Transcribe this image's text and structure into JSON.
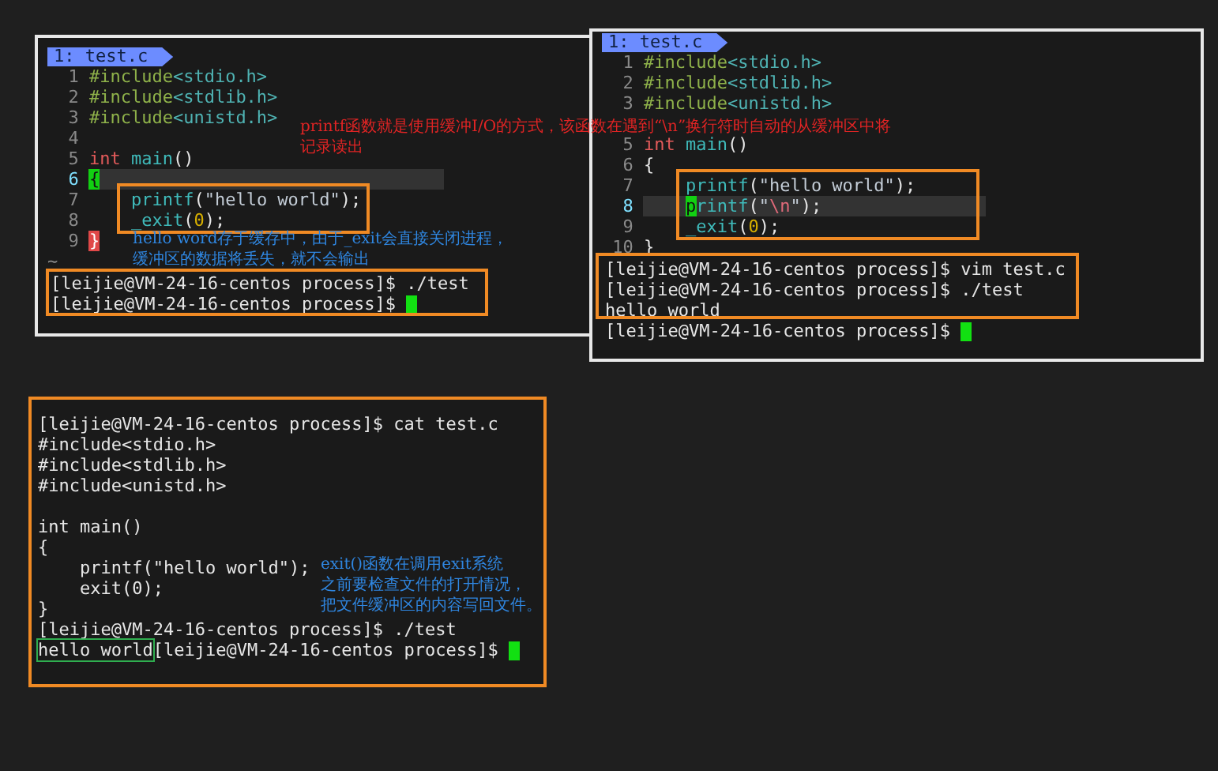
{
  "overlay_note": {
    "color": "#e02424",
    "lines": [
      "printf函数就是使用缓冲I/O的方式，该函数在遇到“\\n”换行符时自动的从缓冲区中将",
      "记录读出"
    ]
  },
  "panels": [
    {
      "kind": "vim",
      "tab": "1: test.c",
      "lines": [
        {
          "number": "1",
          "current": false,
          "tokens": [
            {
              "kind": "pre",
              "text": "#include"
            },
            {
              "kind": "hdr",
              "text": "<stdio.h>"
            }
          ]
        },
        {
          "number": "2",
          "current": false,
          "tokens": [
            {
              "kind": "pre",
              "text": "#include"
            },
            {
              "kind": "hdr",
              "text": "<stdlib.h>"
            }
          ]
        },
        {
          "number": "3",
          "current": false,
          "tokens": [
            {
              "kind": "pre",
              "text": "#include"
            },
            {
              "kind": "hdr",
              "text": "<unistd.h>"
            }
          ]
        },
        {
          "number": "4",
          "current": false
        },
        {
          "number": "5",
          "current": false,
          "tokens": [
            {
              "kind": "kw",
              "text": "int"
            },
            {
              "kind": "fn",
              "text": " main"
            },
            {
              "kind": "plain",
              "text": "()"
            }
          ]
        },
        {
          "number": "6",
          "current": true,
          "tokens": [
            {
              "kind": "cursor",
              "text": "{"
            }
          ]
        },
        {
          "number": "7",
          "current": false,
          "indent": true,
          "tokens": [
            {
              "kind": "fn",
              "text": "printf"
            },
            {
              "kind": "plain",
              "text": "("
            },
            {
              "kind": "str",
              "text": "\"hello world\""
            },
            {
              "kind": "plain",
              "text": ");"
            }
          ]
        },
        {
          "number": "8",
          "current": false,
          "indent": true,
          "tokens": [
            {
              "kind": "fn",
              "text": "_exit"
            },
            {
              "kind": "plain",
              "text": "("
            },
            {
              "kind": "num",
              "text": "0"
            },
            {
              "kind": "plain",
              "text": ");"
            }
          ]
        },
        {
          "number": "9",
          "current": false,
          "tokens": [
            {
              "kind": "match",
              "text": "}"
            }
          ]
        }
      ],
      "tilde": "~",
      "terminal": [
        {
          "text": "[leijie@VM-24-16-centos process]$ ./test"
        },
        {
          "text": "[leijie@VM-24-16-centos process]$",
          "cursor": true
        }
      ],
      "note": {
        "color": "#2f86e0",
        "lines": [
          "hello word存于缓存中，由于_exit会直接关闭进程，",
          "缓冲区的数据将丢失，就不会输出"
        ]
      }
    },
    {
      "kind": "vim",
      "tab": "1: test.c",
      "lines": [
        {
          "number": "1",
          "current": false,
          "tokens": [
            {
              "kind": "pre",
              "text": "#include"
            },
            {
              "kind": "hdr",
              "text": "<stdio.h>"
            }
          ]
        },
        {
          "number": "2",
          "current": false,
          "tokens": [
            {
              "kind": "pre",
              "text": "#include"
            },
            {
              "kind": "hdr",
              "text": "<stdlib.h>"
            }
          ]
        },
        {
          "number": "3",
          "current": false,
          "tokens": [
            {
              "kind": "pre",
              "text": "#include"
            },
            {
              "kind": "hdr",
              "text": "<unistd.h>"
            }
          ]
        },
        {
          "current": false
        },
        {
          "number": "5",
          "current": false,
          "tokens": [
            {
              "kind": "kw",
              "text": "int"
            },
            {
              "kind": "fn",
              "text": " main"
            },
            {
              "kind": "plain",
              "text": "()"
            }
          ]
        },
        {
          "number": "6",
          "current": false,
          "tokens": [
            {
              "kind": "plain",
              "text": "{"
            }
          ]
        },
        {
          "number": "7",
          "current": false,
          "indent": true,
          "tokens": [
            {
              "kind": "fn",
              "text": "printf"
            },
            {
              "kind": "plain",
              "text": "("
            },
            {
              "kind": "str",
              "text": "\"hello world\""
            },
            {
              "kind": "plain",
              "text": ");"
            }
          ]
        },
        {
          "number": "8",
          "current": true,
          "indent": true,
          "tokens": [
            {
              "kind": "cursor",
              "text": "p"
            },
            {
              "kind": "fn",
              "text": "rintf"
            },
            {
              "kind": "plain",
              "text": "("
            },
            {
              "kind": "str",
              "text": "\""
            },
            {
              "kind": "esc",
              "text": "\\n"
            },
            {
              "kind": "str",
              "text": "\""
            },
            {
              "kind": "plain",
              "text": ");"
            }
          ]
        },
        {
          "number": "9",
          "current": false,
          "indent": true,
          "tokens": [
            {
              "kind": "fn",
              "text": "_exit"
            },
            {
              "kind": "plain",
              "text": "("
            },
            {
              "kind": "num",
              "text": "0"
            },
            {
              "kind": "plain",
              "text": ");"
            }
          ]
        },
        {
          "number": "10",
          "current": false,
          "tokens": [
            {
              "kind": "plain",
              "text": "}"
            }
          ]
        }
      ],
      "terminal": [
        {
          "text": "[leijie@VM-24-16-centos process]$ vim test.c"
        },
        {
          "text": "[leijie@VM-24-16-centos process]$ ./test"
        },
        {
          "text": "hello world"
        },
        {
          "text": "[leijie@VM-24-16-centos process]$",
          "cursor": true
        }
      ]
    },
    {
      "kind": "shell",
      "blocks": [
        {
          "lines": [
            {
              "text": "[leijie@VM-24-16-centos process]$ cat test.c"
            },
            {
              "text": "#include<stdio.h>"
            },
            {
              "text": "#include<stdlib.h>"
            },
            {
              "text": "#include<unistd.h>"
            }
          ]
        },
        {
          "lines": [
            {
              "text": "int main()"
            },
            {
              "text": "{"
            },
            {
              "text": "    printf(\"hello world\");"
            },
            {
              "text": "    exit(0);"
            },
            {
              "text": "}"
            },
            {
              "text": "[leijie@VM-24-16-centos process]$ ./test"
            },
            {
              "lead": "hello world",
              "text": "[leijie@VM-24-16-centos process]$",
              "cursor": true
            }
          ]
        }
      ],
      "note": {
        "color": "#2f86e0",
        "lines": [
          "exit()函数在调用exit系统",
          "之前要检查文件的打开情况，",
          "把文件缓冲区的内容写回文件。"
        ]
      }
    }
  ]
}
